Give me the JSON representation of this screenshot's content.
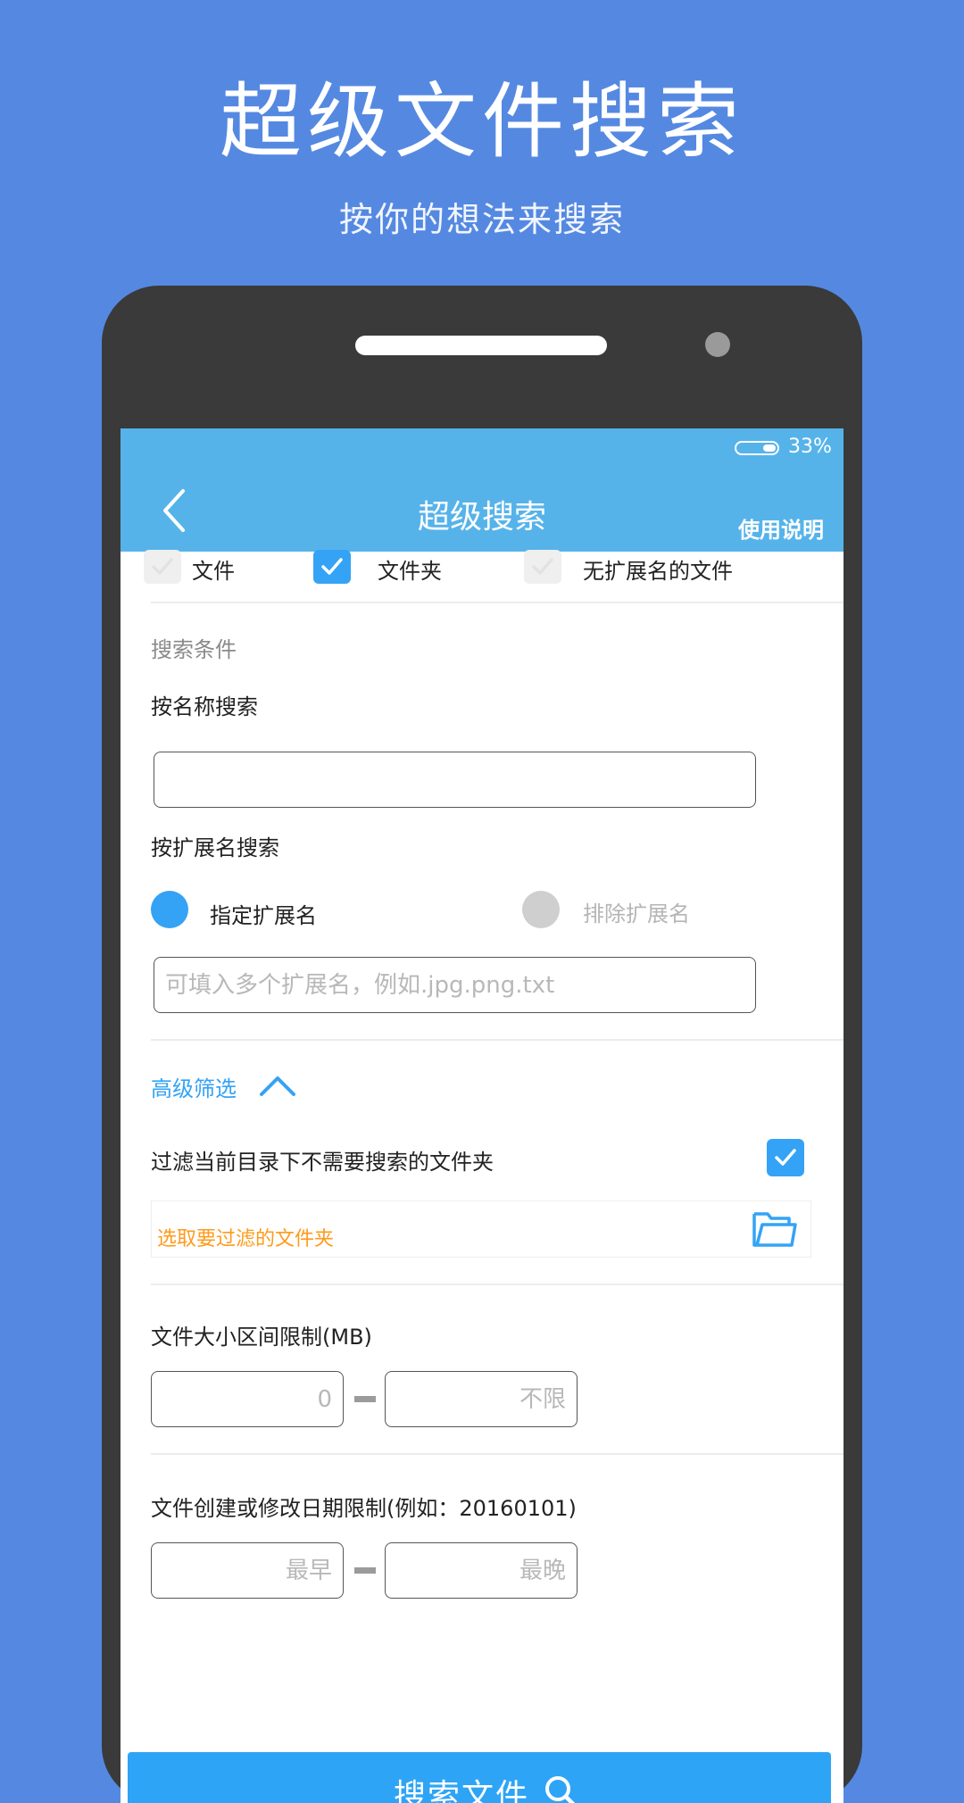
{
  "promo": {
    "headline": "超级文件搜索",
    "subline": "按你的想法来搜索"
  },
  "status_bar": {
    "battery": "33%"
  },
  "app_bar": {
    "title": "超级搜索",
    "help": "使用说明"
  },
  "types": {
    "file": {
      "label": "文件",
      "checked": false
    },
    "folder": {
      "label": "文件夹",
      "checked": true
    },
    "no_ext": {
      "label": "无扩展名的文件",
      "checked": false
    }
  },
  "conditions": {
    "section_title": "搜索条件",
    "name_label": "按名称搜索",
    "name_value": "",
    "ext_label": "按扩展名搜索",
    "ext_include": {
      "label": "指定扩展名",
      "selected": true
    },
    "ext_exclude": {
      "label": "排除扩展名",
      "selected": false
    },
    "ext_placeholder": "可填入多个扩展名，例如.jpg.png.txt"
  },
  "advanced": {
    "title": "高级筛选",
    "filter_label": "过滤当前目录下不需要搜索的文件夹",
    "filter_checked": true,
    "pick_folder": "选取要过滤的文件夹",
    "size_label": "文件大小区间限制(MB)",
    "size_min_placeholder": "0",
    "size_max_placeholder": "不限",
    "date_label": "文件创建或修改日期限制(例如：20160101)",
    "date_min_placeholder": "最早",
    "date_max_placeholder": "最晚"
  },
  "search_button": "搜索文件",
  "colors": {
    "page_bg": "#5589e1",
    "app_bar": "#56b3ea",
    "accent": "#34a3f5",
    "warning_text": "#ff9a1a"
  }
}
